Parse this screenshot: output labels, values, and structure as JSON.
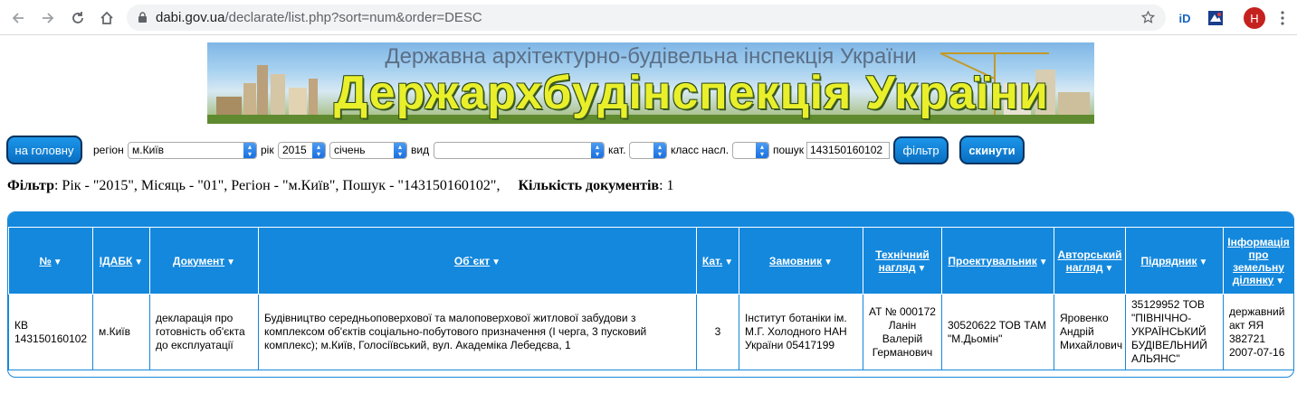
{
  "browser": {
    "url_host": "dabi.gov.ua",
    "url_path": "/declarate/list.php?sort=num&order=DESC",
    "ext1": "iD",
    "avatar": "H"
  },
  "banner": {
    "top_text": "Державна архітектурно-будівельна інспекція України",
    "main_text": "Держархбудінспекція України"
  },
  "filters": {
    "home_button": "на головну",
    "region_label": "регіон",
    "region_value": "м.Київ",
    "year_label": "рік",
    "year_value": "2015",
    "month_value": "січень",
    "type_label": "вид",
    "type_value": "",
    "cat_label": "кат.",
    "cat_value": "",
    "class_label": "класс насл.",
    "class_value": "",
    "search_label": "пошук",
    "search_value": "143150160102",
    "filter_button": "фільтр",
    "reset_button": "скинути"
  },
  "filter_summary": {
    "label": "Фільтр",
    "text": ": Рік - \"2015\", Місяць - \"01\", Регіон - \"м.Київ\", Пошук - \"143150160102\",",
    "count_label": "Кількість документів",
    "count_value": ": 1"
  },
  "table": {
    "headers": [
      "№",
      "ІДАБК",
      "Документ",
      "Об`єкт",
      "Кат.",
      "Замовник",
      "Технічний нагляд",
      "Проектувальник",
      "Авторський нагляд",
      "Підрядник",
      "Інформація про земельну ділянку"
    ],
    "row": {
      "num": "КВ 143150160102",
      "idabk": "м.Київ",
      "document": "декларація про готовність об'єкта до експлуатації",
      "object": "Будівництво середньоповерхової та малоповерхової житлової забудови з комплексом об'єктів соціально-побутового призначення (І черга, 3 пусковий комплекс); м.Київ, Голосіївський, вул. Академіка Лебедєва, 1",
      "cat": "3",
      "customer": "Інститут ботаніки ім. М.Г. Холодного НАН України 05417199",
      "tech_supervision": "АТ № 000172 Ланін Валерій Германович",
      "designer": "30520622 ТОВ ТАМ \"М.Дьомін\"",
      "author_supervision": "Яровенко Андрій Михайлович",
      "contractor": "35129952 ТОВ \"ПІВНІЧНО-УКРАЇНСЬКИЙ БУДІВЕЛЬНИЙ АЛЬЯНС\"",
      "land_info": "державний акт ЯЯ 382721 2007-07-16"
    }
  }
}
